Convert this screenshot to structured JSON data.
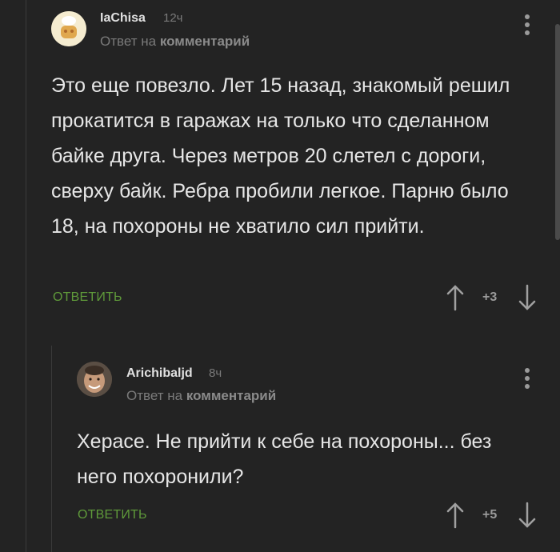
{
  "comments": [
    {
      "author": "IaChisa",
      "time": "12ч",
      "reply_prefix": "Ответ на",
      "reply_target": "комментарий",
      "text": "Это еще повезло. Лет 15 назад, знакомый решил прокатится в гаражах на только что сделанном байке друга. Через метров 20 слетел с дороги, сверху байк. Ребра пробили легкое. Парню было 18, на похороны не хватило сил прийти.",
      "reply_label": "ОТВЕТИТЬ",
      "rating": "+3"
    },
    {
      "author": "Arichibaljd",
      "time": "8ч",
      "reply_prefix": "Ответ на",
      "reply_target": "комментарий",
      "text": "Херасе. Не прийти к себе на похороны... без него похоронили?",
      "reply_label": "ОТВЕТИТЬ",
      "rating": "+5"
    }
  ],
  "colors": {
    "background": "#232323",
    "accent_green": "#5f9a3a",
    "muted": "#7a7a7a"
  },
  "icons": [
    "more-vertical-icon",
    "arrow-up-icon",
    "arrow-down-icon"
  ]
}
